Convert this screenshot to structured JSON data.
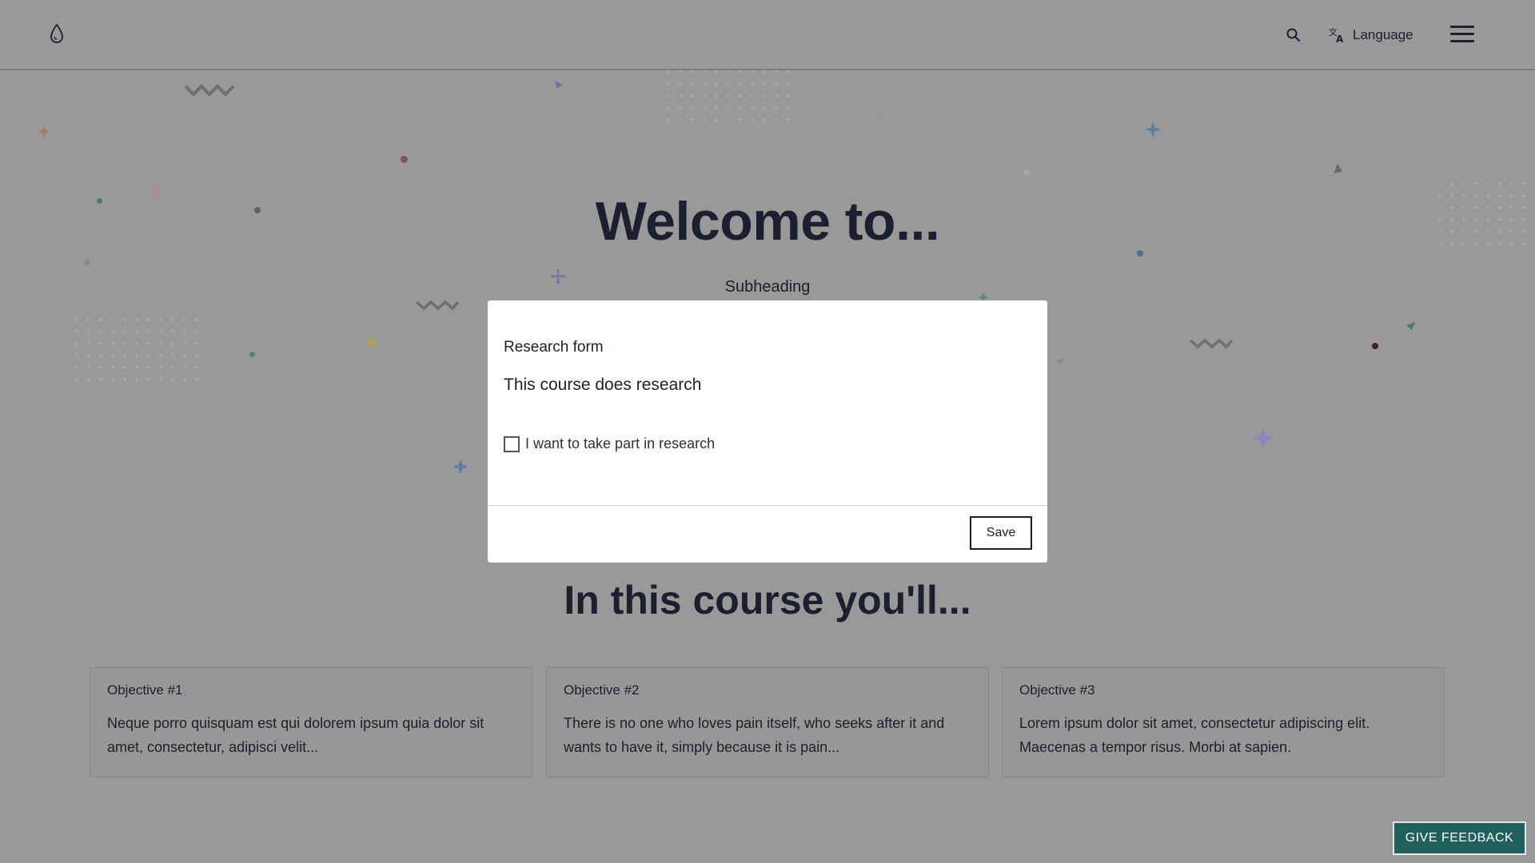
{
  "header": {
    "logo_icon": "droplet-icon",
    "search_icon": "search-icon",
    "language_icon": "translate-icon",
    "language_label": "Language",
    "menu_icon": "hamburger-menu-icon"
  },
  "hero": {
    "title": "Welcome to...",
    "subheading": "Subheading"
  },
  "objectives": {
    "heading": "In this course you'll...",
    "items": [
      {
        "title": "Objective #1",
        "text": "Neque porro quisquam est qui dolorem ipsum quia dolor sit amet, consectetur, adipisci velit..."
      },
      {
        "title": "Objective #2",
        "text": "There is no one who loves pain itself, who seeks after it and wants to have it, simply because it is pain..."
      },
      {
        "title": "Objective #3",
        "text": "Lorem ipsum dolor sit amet, consectetur adipiscing elit. Maecenas a tempor risus. Morbi at sapien."
      }
    ]
  },
  "modal": {
    "title": "Research form",
    "description": "This course does research",
    "checkbox_label": "I want to take part in research",
    "checkbox_checked": false,
    "save_label": "Save"
  },
  "feedback": {
    "label": "GIVE FEEDBACK"
  },
  "colors": {
    "overlay_background": "#999999",
    "text_dark": "#1b1f2e",
    "feedback_button": "#1f5f5c",
    "modal_background": "#ffffff"
  }
}
